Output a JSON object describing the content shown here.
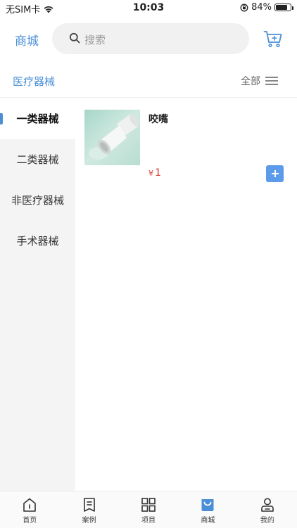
{
  "status_bar": {
    "carrier": "无SIM卡",
    "time": "10:03",
    "battery_text": "84%",
    "battery_level": 0.84
  },
  "header": {
    "title": "商城",
    "search_placeholder": "搜索"
  },
  "category_bar": {
    "current": "医疗器械",
    "all_label": "全部"
  },
  "sidebar": {
    "items": [
      {
        "label": "一类器械",
        "active": true
      },
      {
        "label": "二类器械",
        "active": false
      },
      {
        "label": "非医疗器械",
        "active": false
      },
      {
        "label": "手术器械",
        "active": false
      }
    ]
  },
  "products": [
    {
      "name": "咬嘴",
      "currency": "¥",
      "price": "1"
    }
  ],
  "tab_bar": {
    "items": [
      {
        "label": "首页",
        "icon": "home-icon"
      },
      {
        "label": "案例",
        "icon": "case-icon"
      },
      {
        "label": "项目",
        "icon": "project-icon"
      },
      {
        "label": "商城",
        "icon": "shop-icon",
        "active": true
      },
      {
        "label": "我的",
        "icon": "profile-icon"
      }
    ]
  },
  "colors": {
    "accent": "#4a8fd6",
    "price": "#d63a2a",
    "add_button": "#5b9bea",
    "sidebar_bg": "#f4f4f4"
  }
}
